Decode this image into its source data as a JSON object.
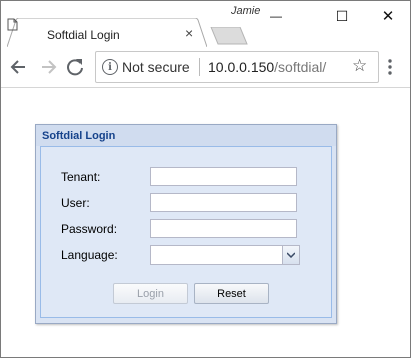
{
  "window": {
    "user_name": "Jamie",
    "minimize_symbol": "—",
    "maximize_symbol": "☐",
    "close_symbol": "✕"
  },
  "tab": {
    "title": "Softdial Login",
    "close_symbol": "×"
  },
  "toolbar": {
    "security_label": "Not secure",
    "url_host": "10.0.0.150",
    "url_path": "/softdial/"
  },
  "dialog": {
    "title": "Softdial Login",
    "fields": {
      "tenant_label": "Tenant:",
      "tenant_value": "",
      "user_label": "User:",
      "user_value": "",
      "password_label": "Password:",
      "password_value": "",
      "language_label": "Language:",
      "language_value": ""
    },
    "buttons": {
      "login_label": "Login",
      "reset_label": "Reset"
    }
  },
  "colors": {
    "dialog_title": "#15428b",
    "dialog_background": "#dfe8f6",
    "dialog_border": "#99bbe8"
  },
  "icons": [
    "page-icon",
    "back-arrow-icon",
    "forward-arrow-icon",
    "reload-icon",
    "info-icon",
    "star-icon",
    "menu-icon",
    "chevron-down-icon"
  ]
}
